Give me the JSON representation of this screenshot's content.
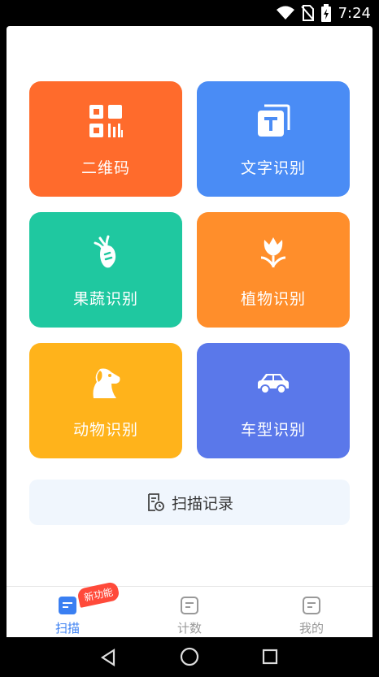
{
  "status": {
    "time": "7:24"
  },
  "tiles": {
    "qr": {
      "label": "二维码",
      "color": "#ff6b2c",
      "icon": "qr-code-icon"
    },
    "text": {
      "label": "文字识别",
      "color": "#4a8cf5",
      "icon": "text-recognition-icon"
    },
    "veg": {
      "label": "果蔬识别",
      "color": "#1fc8a0",
      "icon": "carrot-icon"
    },
    "plant": {
      "label": "植物识别",
      "color": "#ff8e2b",
      "icon": "tulip-icon"
    },
    "animal": {
      "label": "动物识别",
      "color": "#ffb31b",
      "icon": "dog-icon"
    },
    "car": {
      "label": "车型识别",
      "color": "#5a78ea",
      "icon": "car-icon"
    }
  },
  "records": {
    "label": "扫描记录",
    "icon": "document-clock-icon"
  },
  "tabs": {
    "scan": {
      "label": "扫描",
      "badge": "新功能",
      "active_color": "#3a7ff2"
    },
    "count": {
      "label": "计数"
    },
    "mine": {
      "label": "我的"
    }
  }
}
